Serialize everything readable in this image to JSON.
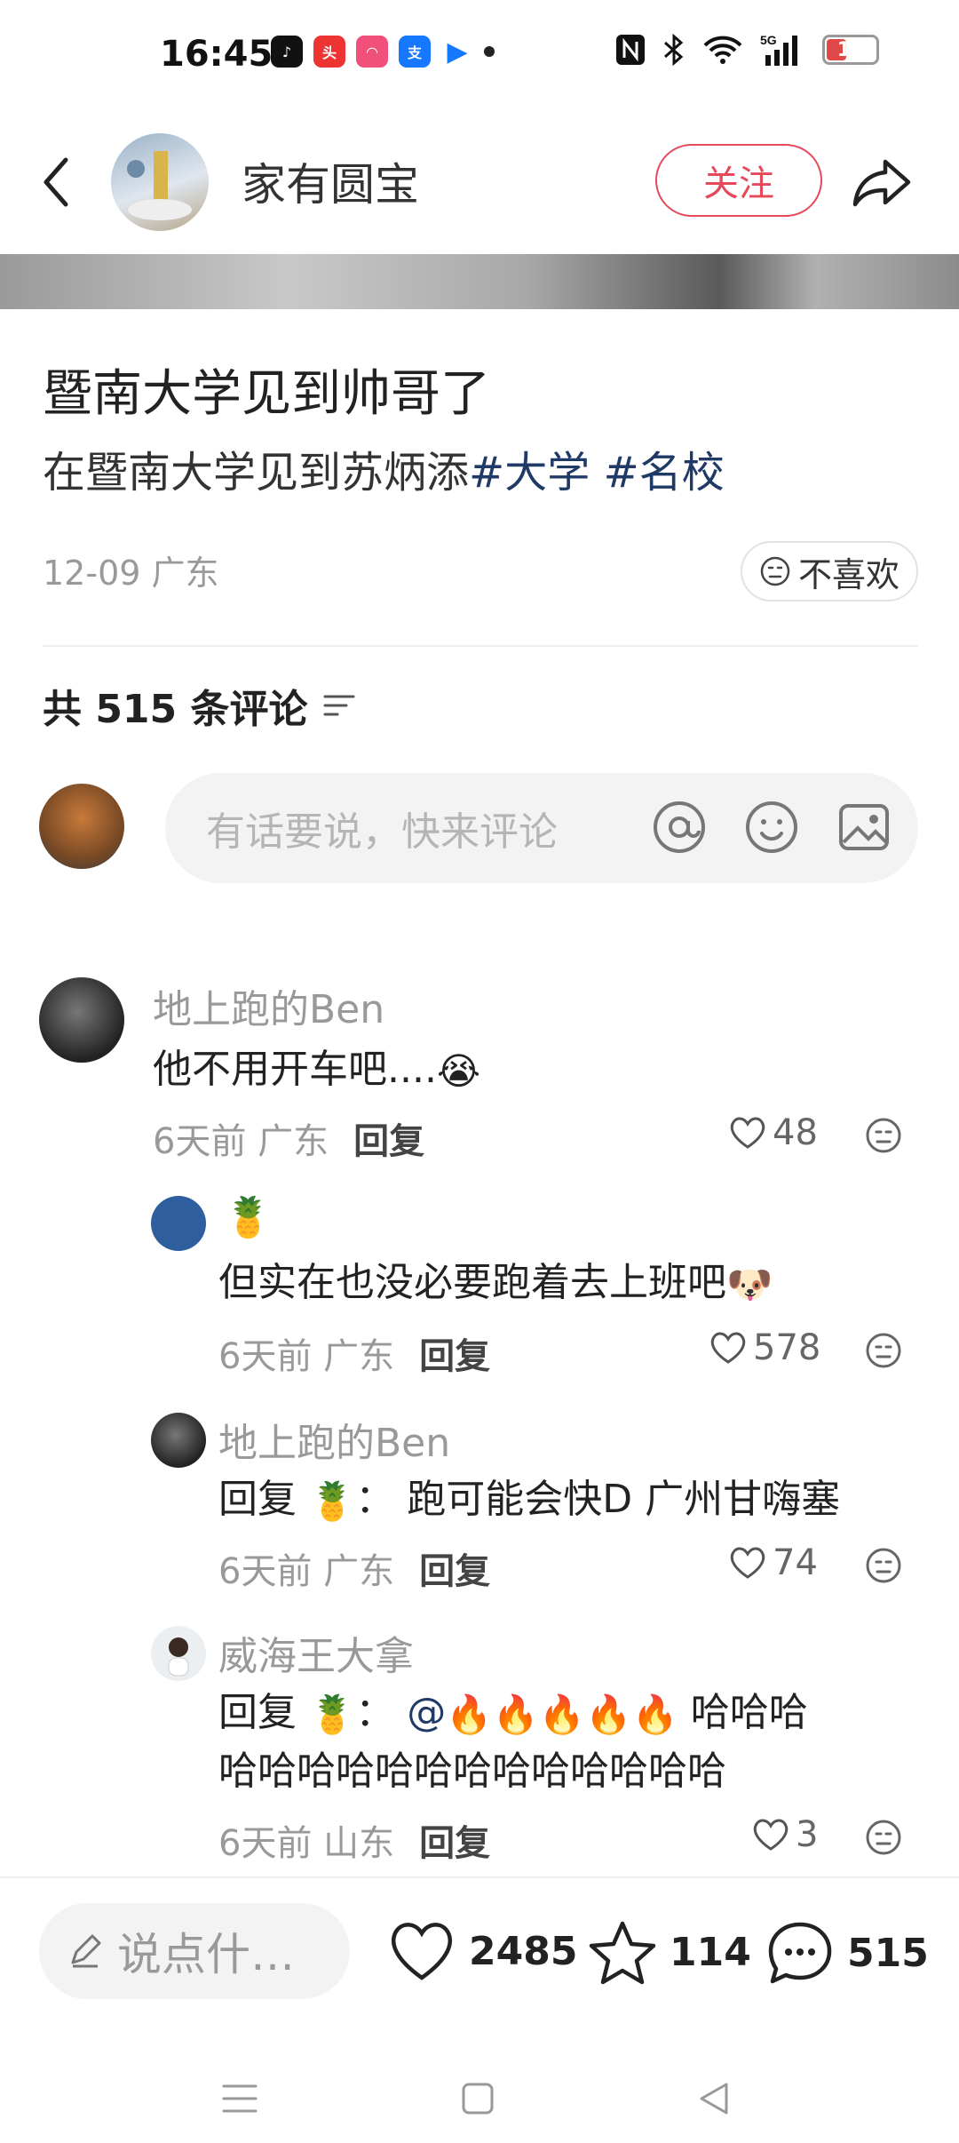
{
  "status_bar": {
    "time": "16:45",
    "battery": "14",
    "network": "5G"
  },
  "header": {
    "author_name": "家有圆宝",
    "follow_label": "关注"
  },
  "post": {
    "title": "暨南大学见到帅哥了",
    "body_text": "在暨南大学见到苏炳添",
    "tags": [
      "#大学",
      "#名校"
    ],
    "date": "12-09",
    "location": "广东",
    "dislike_label": "不喜欢"
  },
  "comments_section": {
    "count_label": "共 515 条评论",
    "input_placeholder": "有话要说，快来评论"
  },
  "comments": [
    {
      "user": "地上跑的Ben",
      "text": "他不用开车吧....",
      "emoji": "😭",
      "time": "6天前",
      "location": "广东",
      "reply_label": "回复",
      "likes": "48"
    },
    {
      "user": "🍍",
      "text": "但实在也没必要跑着去上班吧",
      "emoji": "🐶",
      "time": "6天前",
      "location": "广东",
      "reply_label": "回复",
      "likes": "578"
    },
    {
      "user": "地上跑的Ben",
      "reply_prefix": "回复",
      "reply_to": "🍍",
      "text": "跑可能会快D 广州甘嗨塞",
      "time": "6天前",
      "location": "广东",
      "reply_label": "回复",
      "likes": "74"
    },
    {
      "user": "威海王大拿",
      "reply_prefix": "回复",
      "reply_to": "🍍",
      "at": "@",
      "fires": "🔥🔥🔥🔥🔥",
      "text_line1": "哈哈哈",
      "text_line2": "哈哈哈哈哈哈哈哈哈哈哈哈哈",
      "time": "6天前",
      "location": "山东",
      "reply_label": "回复",
      "likes": "3"
    }
  ],
  "bottom_bar": {
    "say_placeholder": "说点什…",
    "likes": "2485",
    "favorites": "114",
    "comments": "515"
  },
  "colors": {
    "accent": "#e5495a",
    "tag": "#1f3a66",
    "muted": "#999999"
  }
}
